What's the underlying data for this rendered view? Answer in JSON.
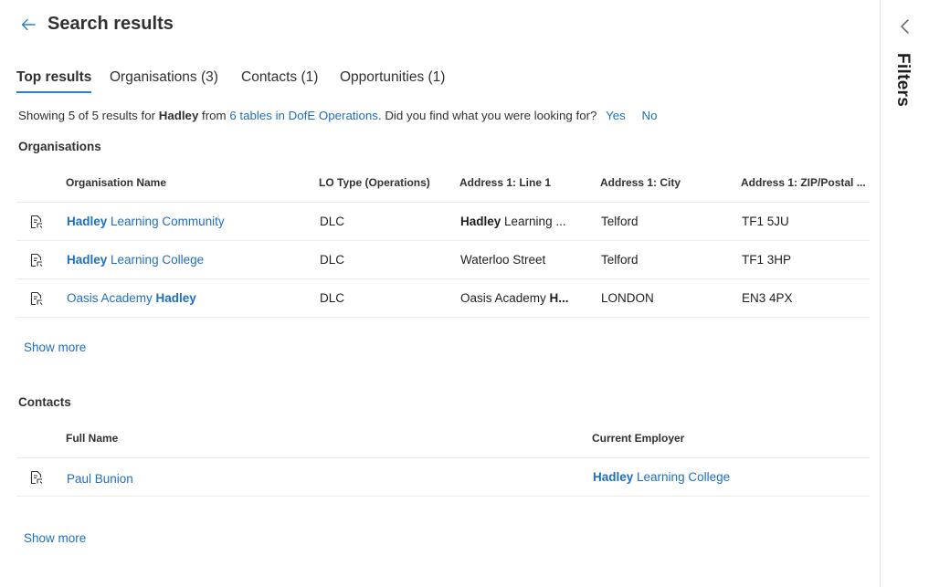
{
  "header": {
    "title": "Search results",
    "back_icon": "back-arrow-icon"
  },
  "tabs": [
    {
      "label": "Top results",
      "active": true
    },
    {
      "label": "Organisations (3)",
      "active": false
    },
    {
      "label": "Contacts (1)",
      "active": false
    },
    {
      "label": "Opportunities (1)",
      "active": false
    }
  ],
  "summary": {
    "prefix": "Showing 5 of 5 results for ",
    "query": "Hadley",
    "middle": " from ",
    "tables_link": "6 tables in DofE Operations",
    "question": ". Did you find what you were looking for?",
    "yes": "Yes",
    "no": "No"
  },
  "organisations": {
    "title": "Organisations",
    "columns": [
      "Organisation Name",
      "LO Type (Operations)",
      "Address 1: Line 1",
      "Address 1: City",
      "Address 1: ZIP/Postal ..."
    ],
    "rows": [
      {
        "name_pre": "",
        "name_bold": "Hadley",
        "name_post": " Learning Community",
        "lo_type": "DLC",
        "line1_bold": "Hadley",
        "line1_post": " Learning ...",
        "city": "Telford",
        "zip": "TF1 5JU"
      },
      {
        "name_pre": "",
        "name_bold": "Hadley",
        "name_post": " Learning College",
        "lo_type": "DLC",
        "line1_bold": "",
        "line1_post": "Waterloo Street",
        "city": "Telford",
        "zip": "TF1 3HP"
      },
      {
        "name_pre": "Oasis Academy ",
        "name_bold": "Hadley",
        "name_post": "",
        "lo_type": "DLC",
        "line1_bold": "",
        "line1_post": "Oasis Academy ",
        "line1_tail_bold": "H...",
        "city": "LONDON",
        "zip": "EN3 4PX"
      }
    ],
    "show_more": "Show more"
  },
  "contacts": {
    "title": "Contacts",
    "columns": [
      "Full Name",
      "Current Employer"
    ],
    "rows": [
      {
        "name": "Paul Bunion",
        "employer_bold": "Hadley",
        "employer_post": " Learning College"
      }
    ],
    "show_more": "Show more"
  },
  "filters": {
    "label": "Filters",
    "icon": "chevron-left-icon"
  },
  "colors": {
    "link": "#1e6fbf",
    "tab_underline": "#2b7fd0",
    "divider": "#edebe9"
  }
}
